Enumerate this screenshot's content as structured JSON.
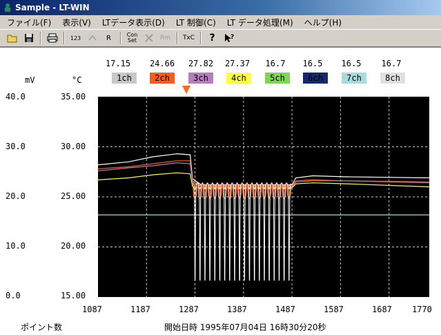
{
  "window": {
    "title": "Sample - LT-WIN"
  },
  "menu": [
    "ファイル(F)",
    "表示(V)",
    "LTデータ表示(D)",
    "LT 制御(C)",
    "LT データ処理(M)",
    "ヘルプ(H)"
  ],
  "toolbar": {
    "icons": [
      "folder-open-icon",
      "save-icon",
      "print-icon",
      "counter-icon",
      "remote-icon",
      "condition-set-icon",
      "repeat-measure-icon",
      "thermocouple-icon",
      "help-icon",
      "context-help-icon"
    ],
    "counter_label": "123",
    "r_label": "R",
    "con_label": "Con",
    "set_label": "Set",
    "rm_label": "Rm",
    "tc_label": "TxC",
    "help_label": "?"
  },
  "units": {
    "left": "mV",
    "right": "°C"
  },
  "channels": [
    {
      "label": "1ch",
      "value": "17.15",
      "color": "#c8c8c8",
      "text_color": "#000000"
    },
    {
      "label": "2ch",
      "value": "24.66",
      "color": "#ff5a1a",
      "text_color": "#000000"
    },
    {
      "label": "3ch",
      "value": "27.82",
      "color": "#b87ac0",
      "text_color": "#000000"
    },
    {
      "label": "4ch",
      "value": "27.37",
      "color": "#ffff40",
      "text_color": "#000000"
    },
    {
      "label": "5ch",
      "value": "16.7",
      "color": "#7cd850",
      "text_color": "#000000"
    },
    {
      "label": "6ch",
      "value": "16.5",
      "color": "#14286e",
      "text_color": "#000000"
    },
    {
      "label": "7ch",
      "value": "16.5",
      "color": "#a8dcdc",
      "text_color": "#000000"
    },
    {
      "label": "8ch",
      "value": "16.7",
      "color": "#e0e0e0",
      "text_color": "#000000"
    }
  ],
  "footer": {
    "x_axis_name": "ポイント数",
    "start_time": "開始日時 1995年07月04日 16時30分20秒"
  },
  "chart_data": {
    "type": "line",
    "x_ticks": [
      "1087",
      "1187",
      "1287",
      "1387",
      "1487",
      "1587",
      "1687",
      "1770"
    ],
    "xlim": [
      1087,
      1770
    ],
    "y_left_ticks": [
      "40.0",
      "30.0",
      "20.0",
      "10.0",
      "0.0"
    ],
    "y_left_lim": [
      0,
      40
    ],
    "y_right_ticks": [
      "35.00",
      "30.00",
      "25.00",
      "20.00",
      "15.00"
    ],
    "y_right_lim": [
      15,
      35
    ],
    "grid": true,
    "series": [
      {
        "name": "1ch",
        "color": "#ffffff",
        "points": [
          [
            1087,
            28.2
          ],
          [
            1150,
            28.5
          ],
          [
            1200,
            29.0
          ],
          [
            1250,
            29.3
          ],
          [
            1277,
            29.2
          ],
          [
            1282,
            26.8
          ],
          [
            1300,
            26.2
          ],
          [
            1487,
            26.2
          ],
          [
            1495,
            26.9
          ],
          [
            1530,
            27.1
          ],
          [
            1600,
            27.0
          ],
          [
            1770,
            26.9
          ]
        ]
      },
      {
        "name": "2ch",
        "color": "#ff5a1a",
        "points": [
          [
            1087,
            27.8
          ],
          [
            1150,
            28.0
          ],
          [
            1200,
            28.3
          ],
          [
            1250,
            28.6
          ],
          [
            1277,
            28.6
          ],
          [
            1282,
            26.6
          ],
          [
            1300,
            26.1
          ],
          [
            1487,
            26.1
          ],
          [
            1495,
            26.6
          ],
          [
            1530,
            26.7
          ],
          [
            1600,
            26.6
          ],
          [
            1770,
            26.5
          ]
        ]
      },
      {
        "name": "3ch",
        "color": "#b87ac0",
        "points": [
          [
            1087,
            27.6
          ],
          [
            1150,
            27.9
          ],
          [
            1200,
            28.1
          ],
          [
            1250,
            28.4
          ],
          [
            1277,
            28.3
          ],
          [
            1282,
            26.5
          ],
          [
            1300,
            26.0
          ],
          [
            1487,
            26.0
          ],
          [
            1495,
            26.5
          ],
          [
            1530,
            26.6
          ],
          [
            1600,
            26.6
          ],
          [
            1770,
            26.4
          ]
        ]
      },
      {
        "name": "4ch",
        "color": "#ffff40",
        "points": [
          [
            1087,
            26.7
          ],
          [
            1150,
            26.9
          ],
          [
            1200,
            27.2
          ],
          [
            1250,
            27.4
          ],
          [
            1277,
            27.3
          ],
          [
            1282,
            26.0
          ],
          [
            1300,
            25.9
          ],
          [
            1487,
            25.9
          ],
          [
            1495,
            26.3
          ],
          [
            1530,
            26.4
          ],
          [
            1600,
            26.3
          ],
          [
            1770,
            26.0
          ]
        ]
      },
      {
        "name": "7ch",
        "color": "#a8dcdc",
        "points": [
          [
            1087,
            23.2
          ],
          [
            1770,
            23.2
          ]
        ]
      }
    ]
  }
}
